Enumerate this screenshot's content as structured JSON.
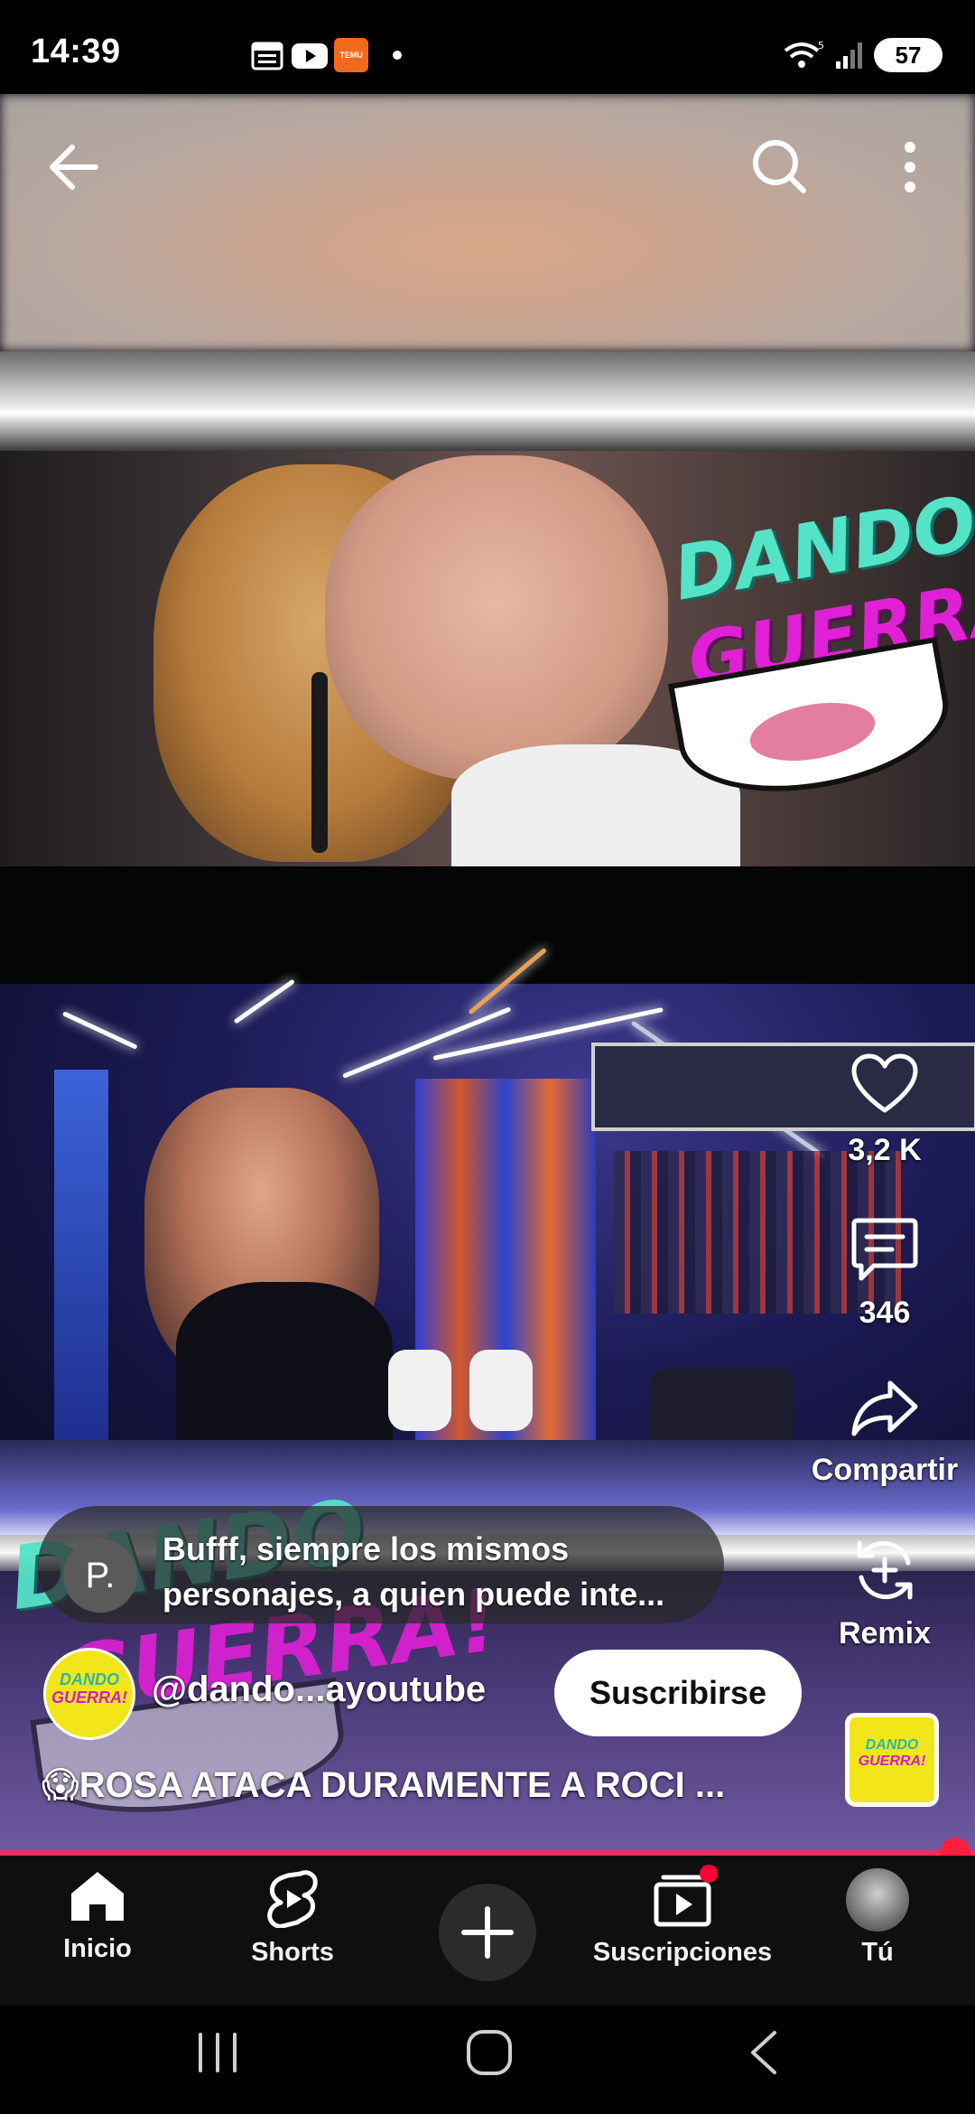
{
  "status_bar": {
    "time": "14:39",
    "battery": "57",
    "notification_icons": [
      "calendar-icon",
      "youtube-icon",
      "temu-icon"
    ],
    "temu_badge": "TEMU"
  },
  "logo": {
    "line1": "DANDO",
    "line2": "GUERRA!",
    "mini_line1": "DANDO",
    "mini_line2": "GUERRA!"
  },
  "actions": {
    "likes": "3,2 K",
    "comments": "346",
    "share": "Compartir",
    "remix": "Remix"
  },
  "comment": {
    "avatar_letter": "P.",
    "line1": "Bufff, siempre los mismos",
    "line2": "personajes, a quien puede inte..."
  },
  "channel": {
    "handle": "@dando...ayoutube",
    "subscribe": "Suscribirse"
  },
  "video": {
    "title": "😱ROSA ATACA DURAMENTE A ROCI ...",
    "progress": 0.98
  },
  "bottom_nav": {
    "home": "Inicio",
    "shorts": "Shorts",
    "subscriptions": "Suscripciones",
    "you": "Tú"
  },
  "colors": {
    "accent": "#ff0033",
    "progress": "#e8335a",
    "logo_cyan": "#54e3c7",
    "logo_magenta": "#e020d6"
  }
}
